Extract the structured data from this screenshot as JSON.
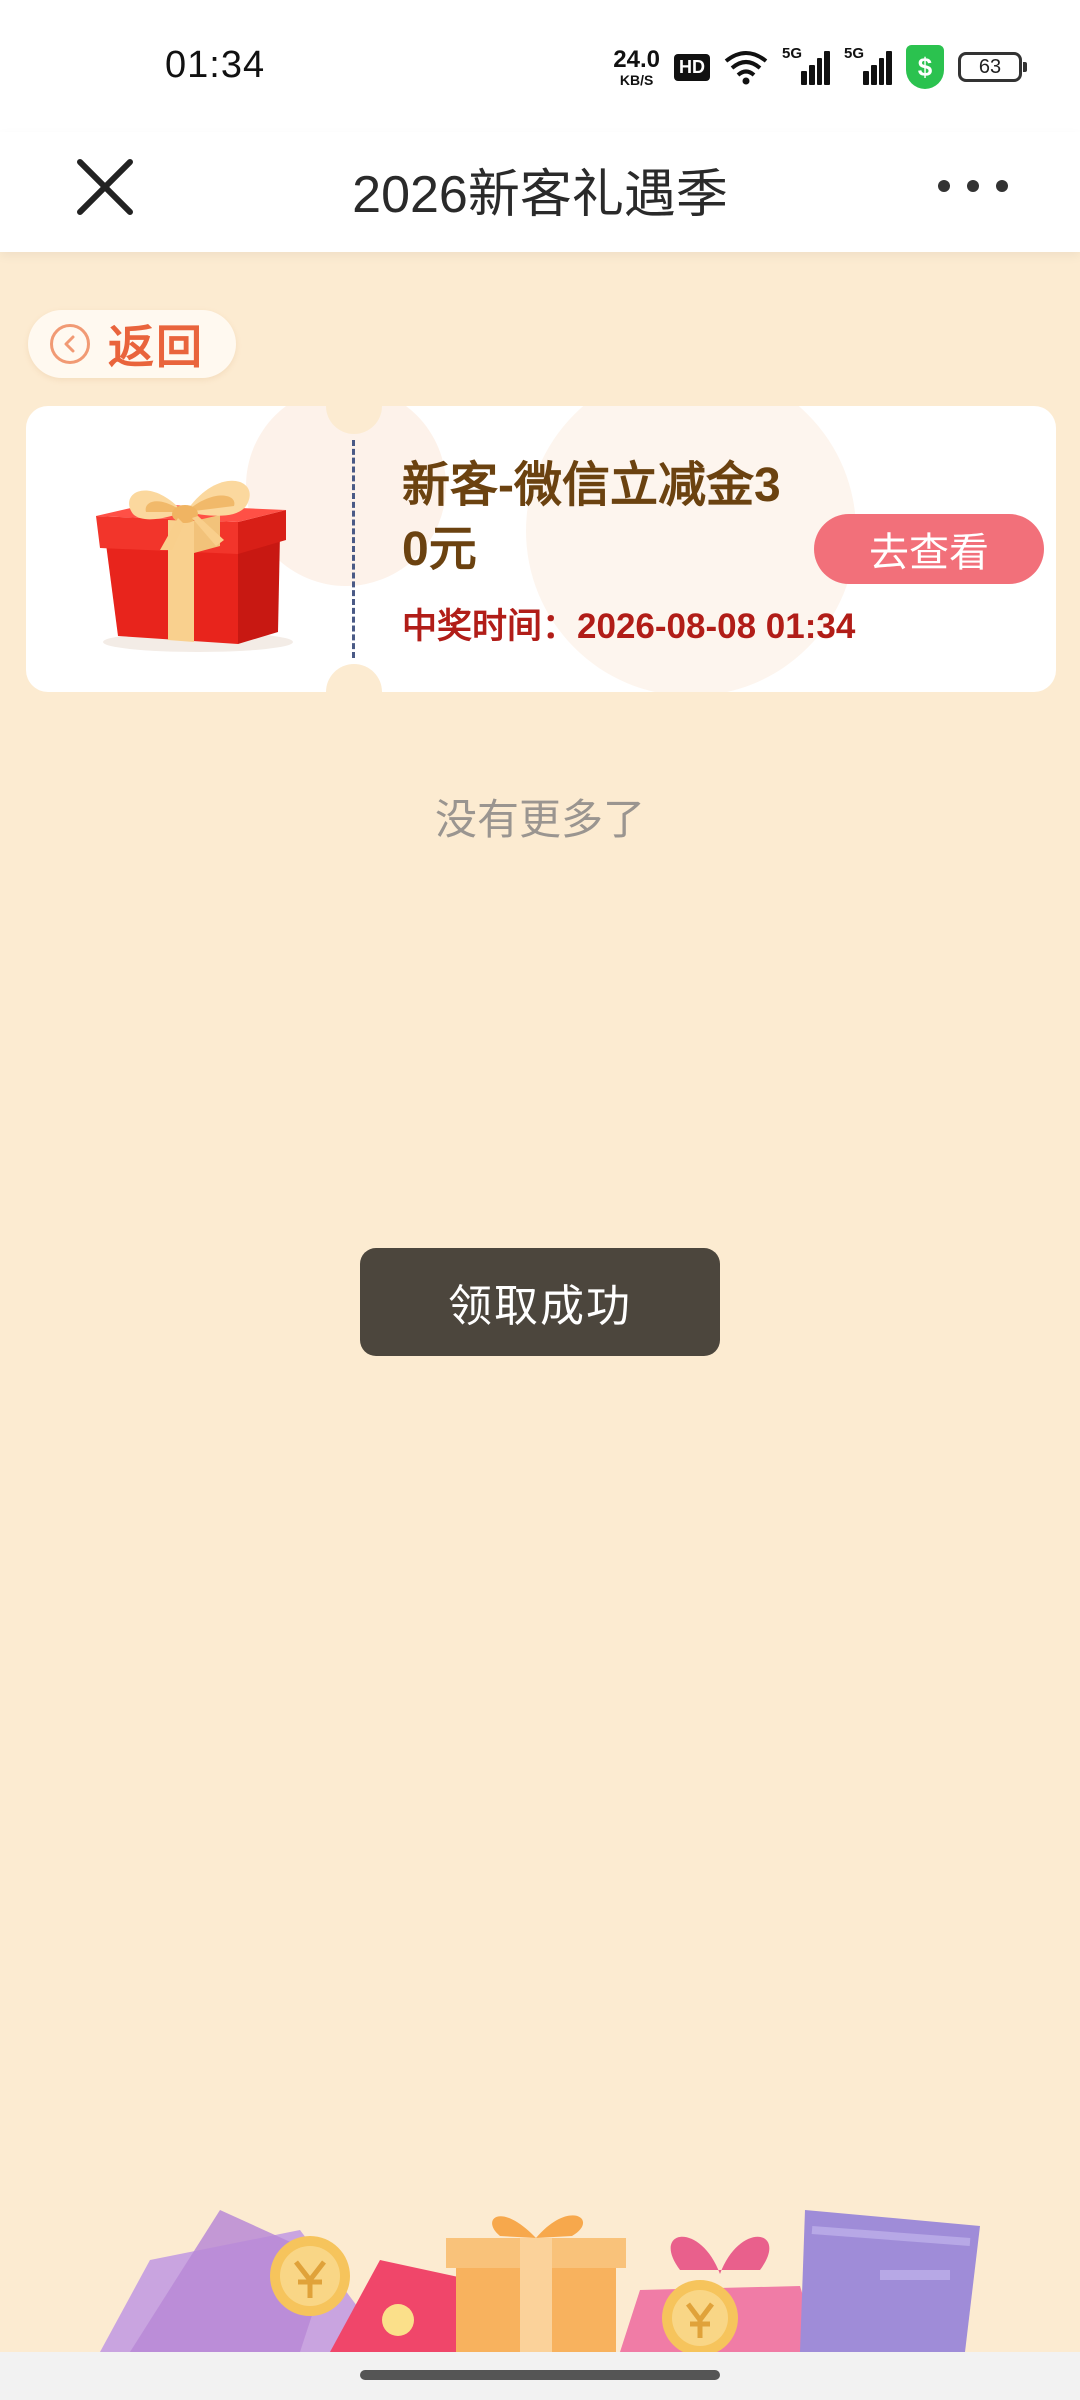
{
  "status_bar": {
    "time": "01:34",
    "net_speed_value": "24.0",
    "net_speed_unit": "KB/S",
    "hd_badge": "HD",
    "signal_1_label": "5G",
    "signal_2_label": "5G",
    "shield_icon": "dollar-shield-icon",
    "shield_glyph": "$",
    "battery_level": "63"
  },
  "header": {
    "title": "2026新客礼遇季",
    "close_icon": "close-icon",
    "more_icon": "more-icon"
  },
  "back": {
    "label": "返回",
    "icon": "chevron-left-circle-icon"
  },
  "prize": {
    "name": "新客-微信立减金30元",
    "time_label": "中奖时间：",
    "time_value": "2026-08-08 01:34",
    "button_label": "去查看",
    "icon": "gift-box-icon"
  },
  "list_end_text": "没有更多了",
  "toast": {
    "text": "领取成功"
  },
  "colors": {
    "page_bg": "#fcebd1",
    "prize_name": "#6b4210",
    "prize_time": "#b11d18",
    "view_button": "#f2707a",
    "back_text": "#e9643c",
    "toast_bg": "#4c463d"
  }
}
